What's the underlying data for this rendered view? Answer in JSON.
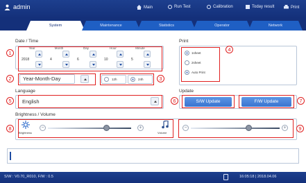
{
  "header": {
    "user": "admin",
    "menu": [
      {
        "label": "Main",
        "icon": "home-icon"
      },
      {
        "label": "Run Test",
        "icon": "run-icon"
      },
      {
        "label": "Calibration",
        "icon": "calibration-icon"
      },
      {
        "label": "Today result",
        "icon": "result-icon"
      },
      {
        "label": "Print",
        "icon": "person-icon"
      }
    ]
  },
  "tabs": [
    "System",
    "Maintenance",
    "Statistics",
    "Operator",
    "Network"
  ],
  "active_tab": "System",
  "datetime": {
    "section_label": "Date / Time",
    "columns": [
      {
        "head": "Year",
        "value": "2018"
      },
      {
        "head": "Month",
        "value": "4"
      },
      {
        "head": "Day",
        "value": "6"
      },
      {
        "head": "Hour",
        "value": "10"
      },
      {
        "head": "Minute",
        "value": "5"
      }
    ],
    "format_value": "Year-Month-Day",
    "hour_12": "12h",
    "hour_24": "24h",
    "hour_selected": "24h"
  },
  "print": {
    "section_label": "Print",
    "options": [
      "1sheet",
      "2sheet",
      "Auto Print"
    ],
    "selected": [
      "1sheet",
      "Auto Print"
    ]
  },
  "language": {
    "section_label": "Language",
    "value": "English"
  },
  "update": {
    "section_label": "Update",
    "sw_label": "S/W Update",
    "fw_label": "F/W Update"
  },
  "brightness": {
    "section_label": "Brightness / Volume",
    "brightness_caption": "Brightness",
    "volume_caption": "Volume",
    "brightness_level": 0.7,
    "volume_level": 0.65
  },
  "callouts": [
    "1",
    "2",
    "3",
    "4",
    "5",
    "6",
    "7",
    "8",
    "9"
  ],
  "footer": {
    "version": "S/W : V0.70_R010, F/W : 0.5",
    "timestamp": "16:05:18 | 2018.04.06"
  },
  "colors": {
    "header": "#14307a",
    "accent": "#3a74cf",
    "callout": "#e02020"
  }
}
